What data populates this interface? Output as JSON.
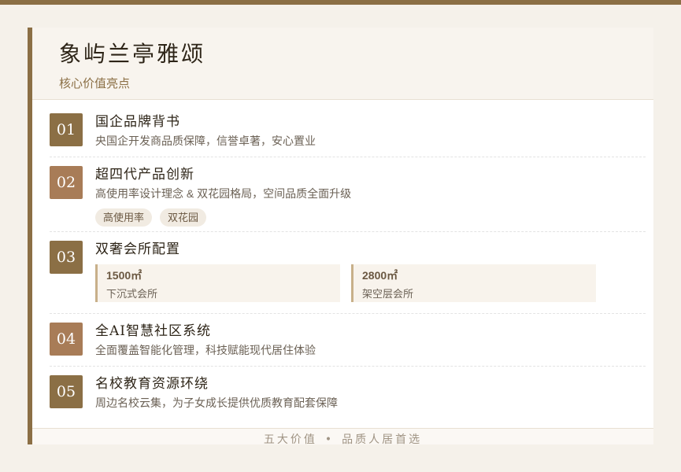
{
  "header": {
    "title": "象屿兰亭雅颂",
    "subtitle": "核心价值亮点"
  },
  "items": [
    {
      "number": "01",
      "title": "国企品牌背书",
      "desc": "央国企开发商品质保障，信誉卓著，安心置业"
    },
    {
      "number": "02",
      "title": "超四代产品创新",
      "desc": "高使用率设计理念 & 双花园格局，空间品质全面升级",
      "tags": [
        "高使用率",
        "双花园"
      ]
    },
    {
      "number": "03",
      "title": "双奢会所配置",
      "stats": [
        {
          "value": "1500㎡",
          "label": "下沉式会所"
        },
        {
          "value": "2800㎡",
          "label": "架空层会所"
        }
      ]
    },
    {
      "number": "04",
      "title": "全AI智慧社区系统",
      "desc": "全面覆盖智能化管理，科技赋能现代居住体验"
    },
    {
      "number": "05",
      "title": "名校教育资源环绕",
      "desc": "周边名校云集，为子女成长提供优质教育配套保障"
    }
  ],
  "footer": {
    "left": "五大价值",
    "separator": "•",
    "right": "品质人居首选"
  },
  "colors": {
    "accent": "#8b6f45",
    "accent_light": "#a87c57",
    "background": "#f5f1ea"
  }
}
